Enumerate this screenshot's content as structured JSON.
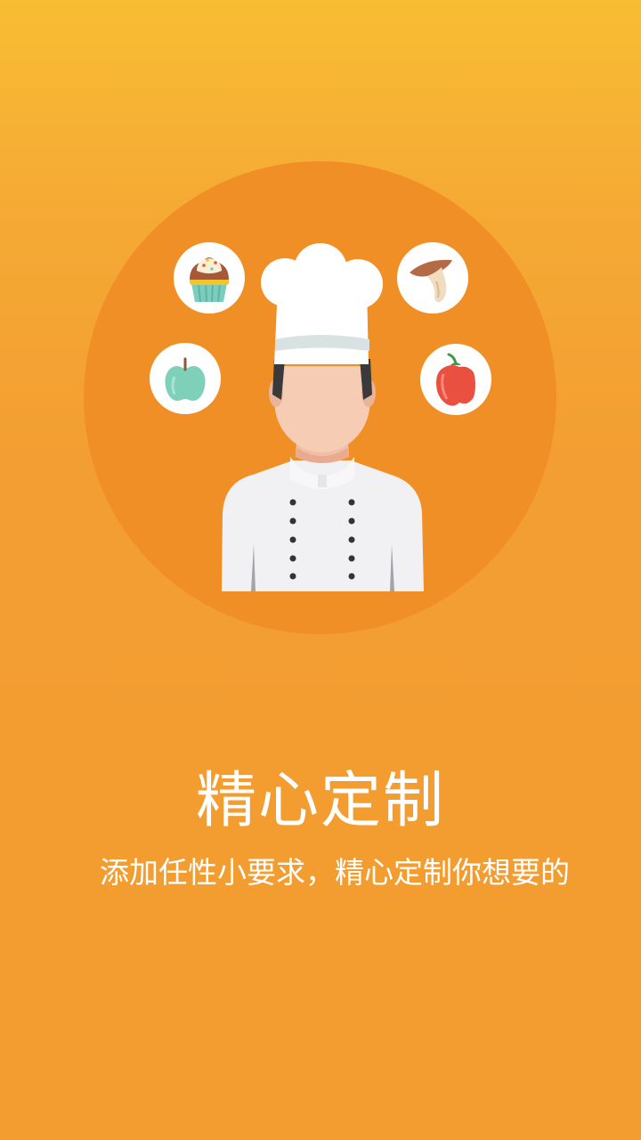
{
  "onboarding": {
    "headline": "精心定制",
    "subline": "添加任性小要求，精心定制你想要的"
  },
  "illustration": {
    "subject": "chef",
    "icons": [
      "cupcake-icon",
      "mushroom-icon",
      "apple-icon",
      "pepper-icon"
    ]
  },
  "colors": {
    "background_top": "#f8bd33",
    "background_bottom": "#f39c30",
    "circle": "#f08d24",
    "white": "#ffffff"
  }
}
